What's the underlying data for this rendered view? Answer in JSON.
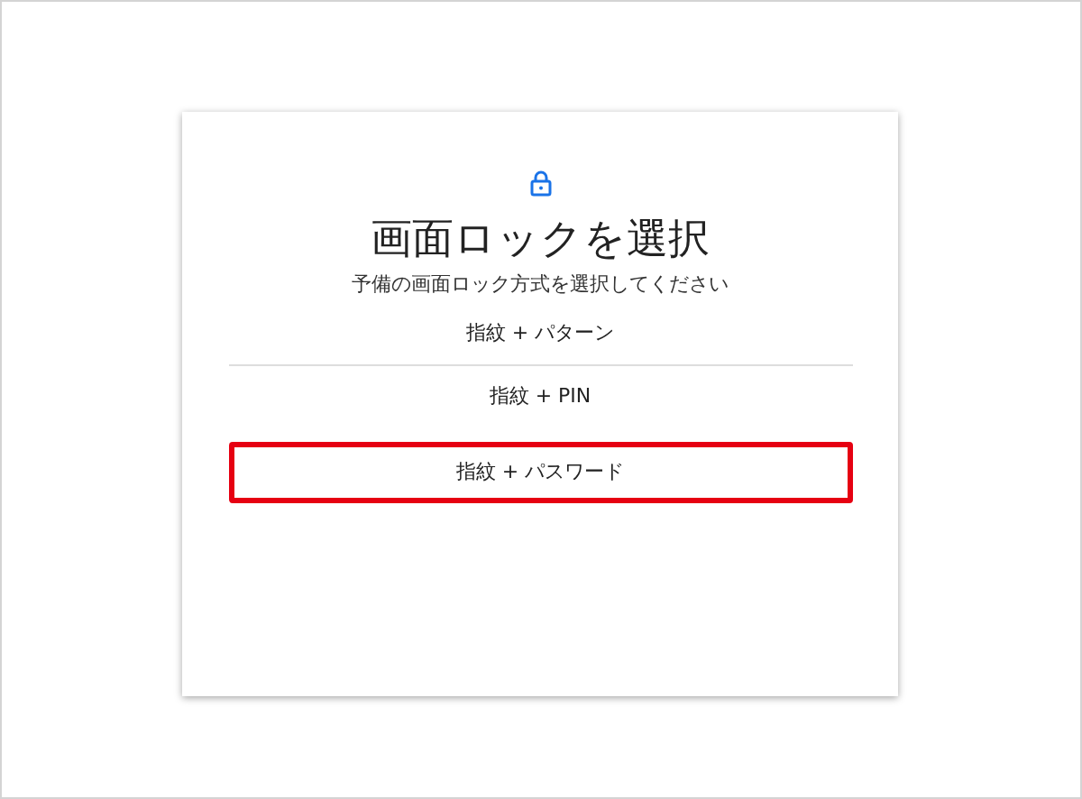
{
  "dialog": {
    "title": "画面ロックを選択",
    "subtitle": "予備の画面ロック方式を選択してください",
    "options": [
      {
        "label": "指紋 + パターン",
        "divider_below": true,
        "highlighted": false
      },
      {
        "label": "指紋 + PIN",
        "divider_below": false,
        "highlighted": false
      },
      {
        "label": "指紋 + パスワード",
        "divider_below": false,
        "highlighted": true
      }
    ]
  }
}
